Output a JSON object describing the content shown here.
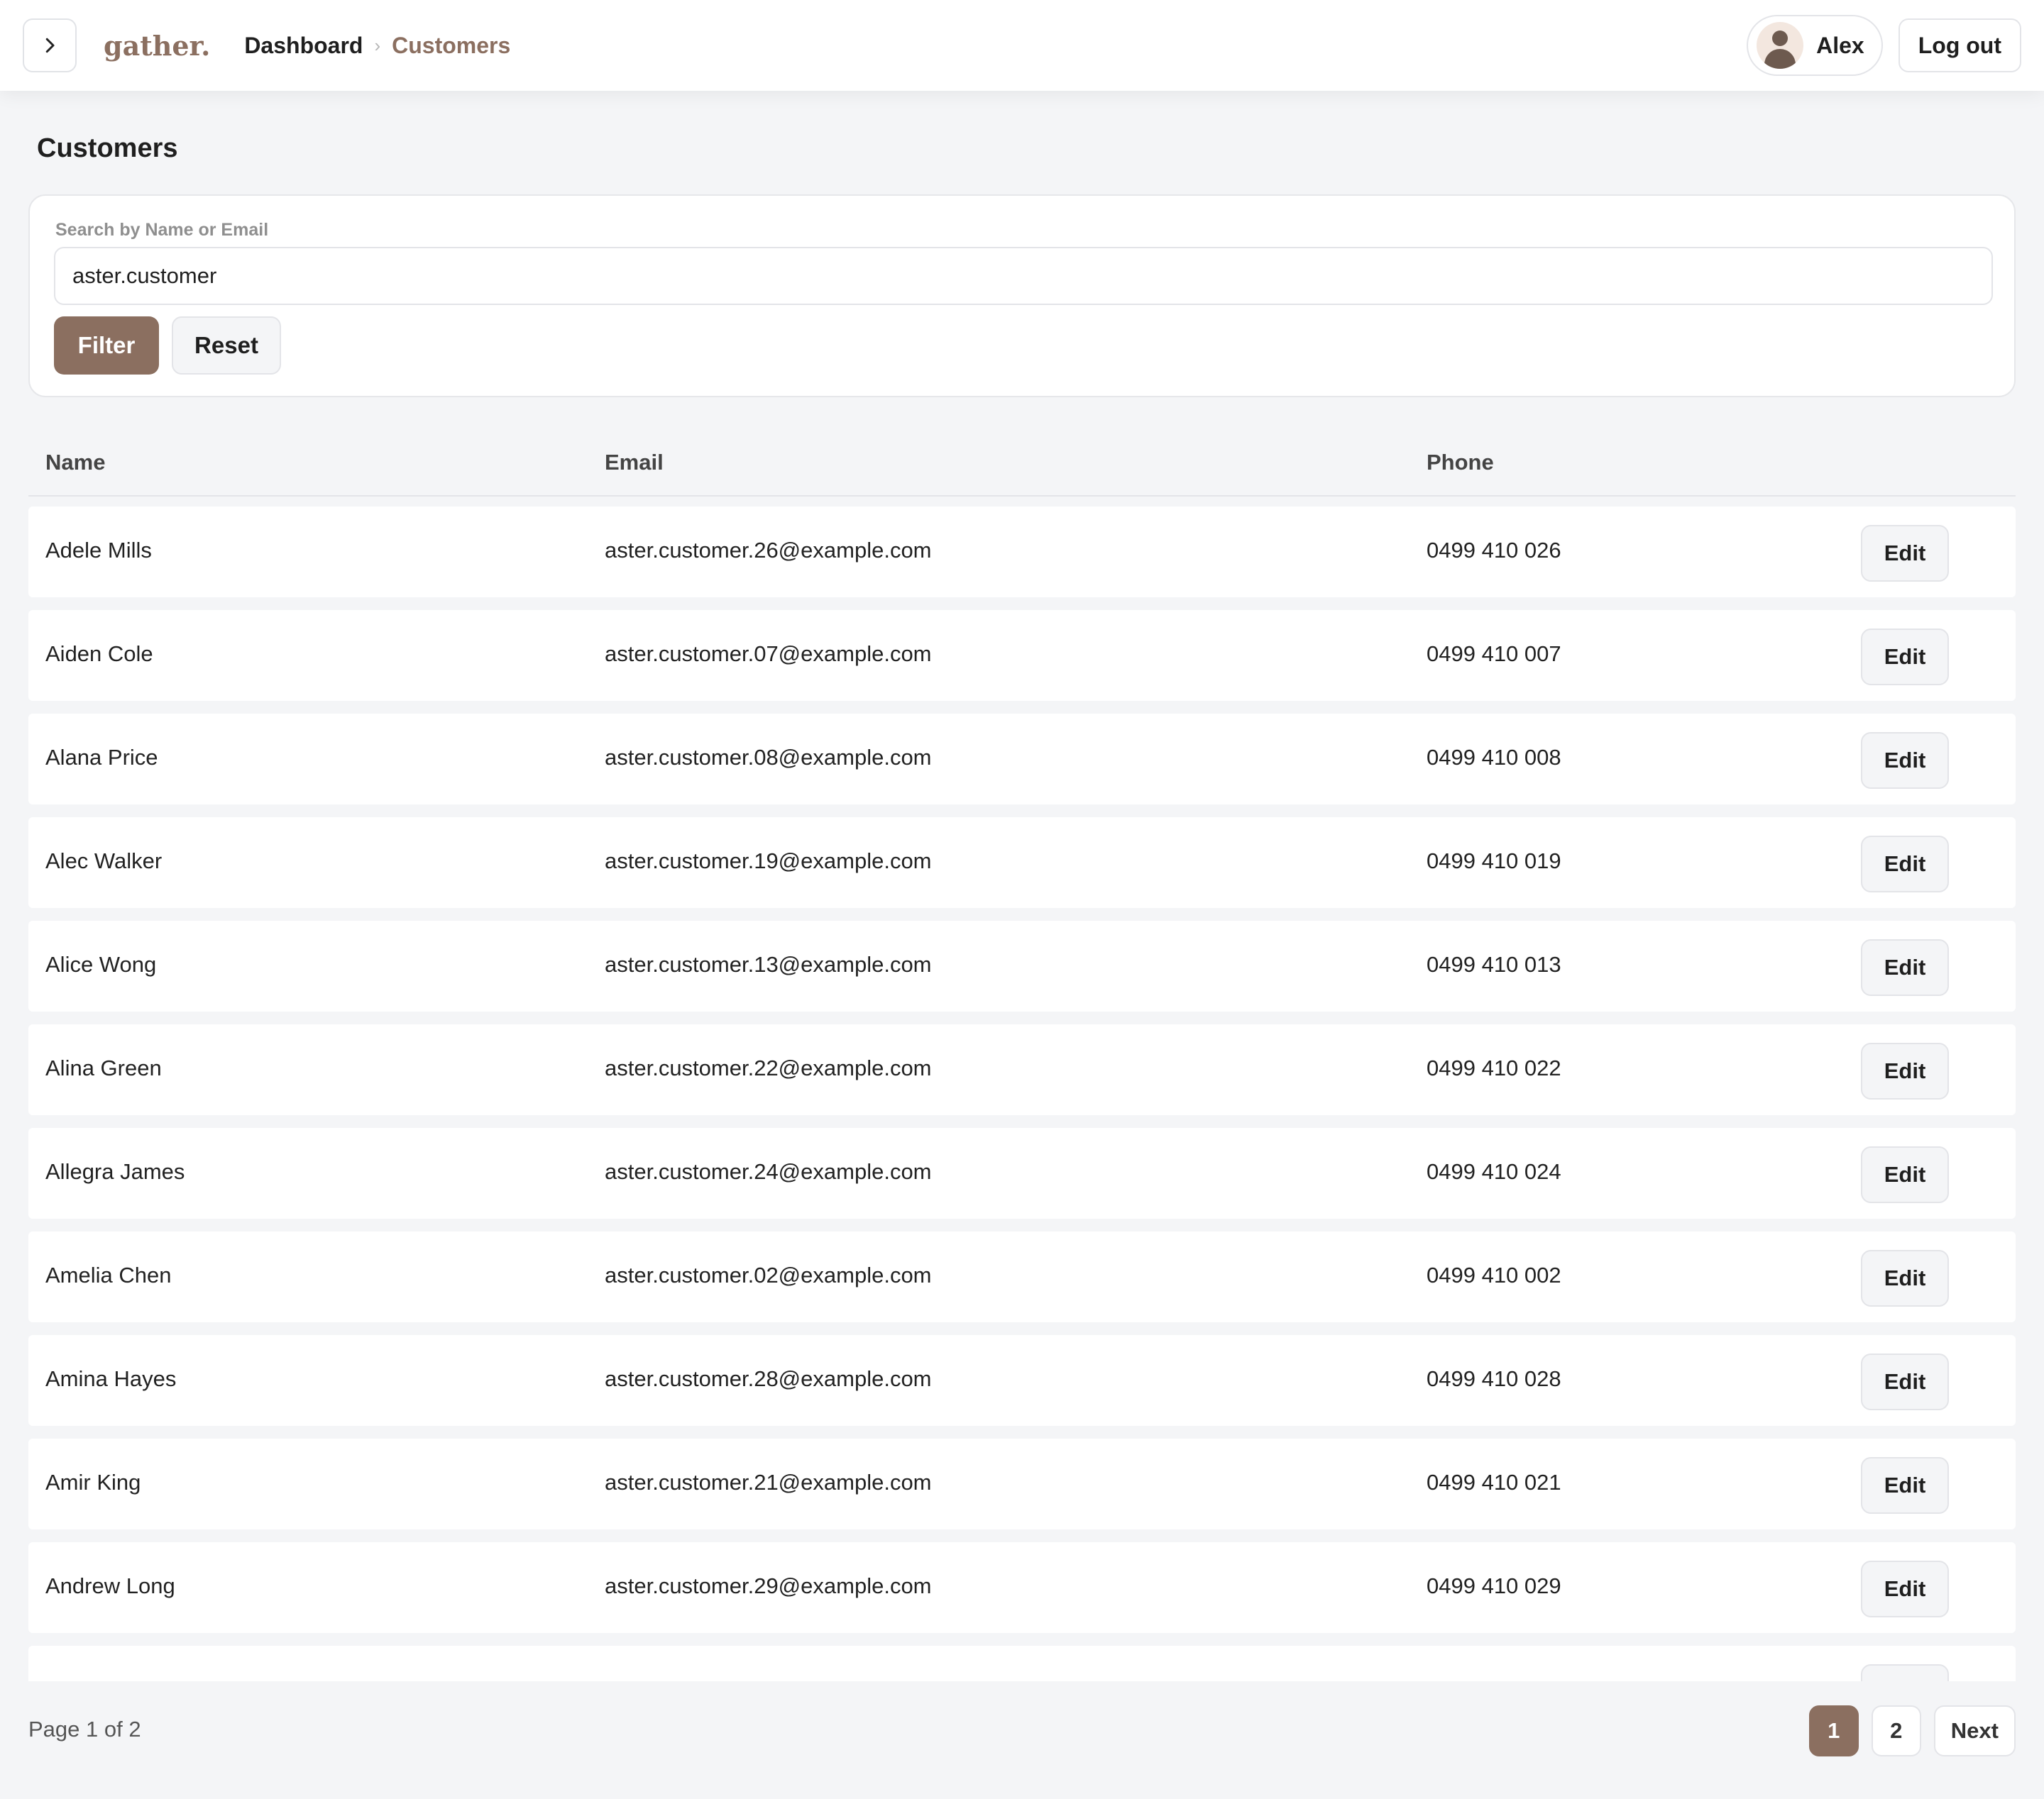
{
  "header": {
    "toggle_icon": "chevron-right-icon",
    "logo": "gather.",
    "breadcrumb": [
      "Dashboard",
      "Customers"
    ],
    "breadcrumb_separator": "›",
    "user_name": "Alex",
    "logout_label": "Log out"
  },
  "page": {
    "title": "Customers"
  },
  "filter": {
    "label": "Search by Name or Email",
    "value": "aster.customer",
    "filter_label": "Filter",
    "reset_label": "Reset"
  },
  "table": {
    "columns": [
      "Name",
      "Email",
      "Phone"
    ],
    "edit_label": "Edit",
    "rows": [
      {
        "name": "Adele Mills",
        "email": "aster.customer.26@example.com",
        "phone": "0499 410 026"
      },
      {
        "name": "Aiden Cole",
        "email": "aster.customer.07@example.com",
        "phone": "0499 410 007"
      },
      {
        "name": "Alana Price",
        "email": "aster.customer.08@example.com",
        "phone": "0499 410 008"
      },
      {
        "name": "Alec Walker",
        "email": "aster.customer.19@example.com",
        "phone": "0499 410 019"
      },
      {
        "name": "Alice Wong",
        "email": "aster.customer.13@example.com",
        "phone": "0499 410 013"
      },
      {
        "name": "Alina Green",
        "email": "aster.customer.22@example.com",
        "phone": "0499 410 022"
      },
      {
        "name": "Allegra James",
        "email": "aster.customer.24@example.com",
        "phone": "0499 410 024"
      },
      {
        "name": "Amelia Chen",
        "email": "aster.customer.02@example.com",
        "phone": "0499 410 002"
      },
      {
        "name": "Amina Hayes",
        "email": "aster.customer.28@example.com",
        "phone": "0499 410 028"
      },
      {
        "name": "Amir King",
        "email": "aster.customer.21@example.com",
        "phone": "0499 410 021"
      },
      {
        "name": "Andrew Long",
        "email": "aster.customer.29@example.com",
        "phone": "0499 410 029"
      },
      {
        "name": "",
        "email": "",
        "phone": ""
      }
    ]
  },
  "pagination": {
    "info": "Page 1 of 2",
    "pages": [
      "1",
      "2"
    ],
    "current": "1",
    "next_label": "Next"
  },
  "colors": {
    "accent": "#8b6f60",
    "background": "#f4f5f7",
    "surface": "#ffffff",
    "border": "#e3e4e8"
  }
}
